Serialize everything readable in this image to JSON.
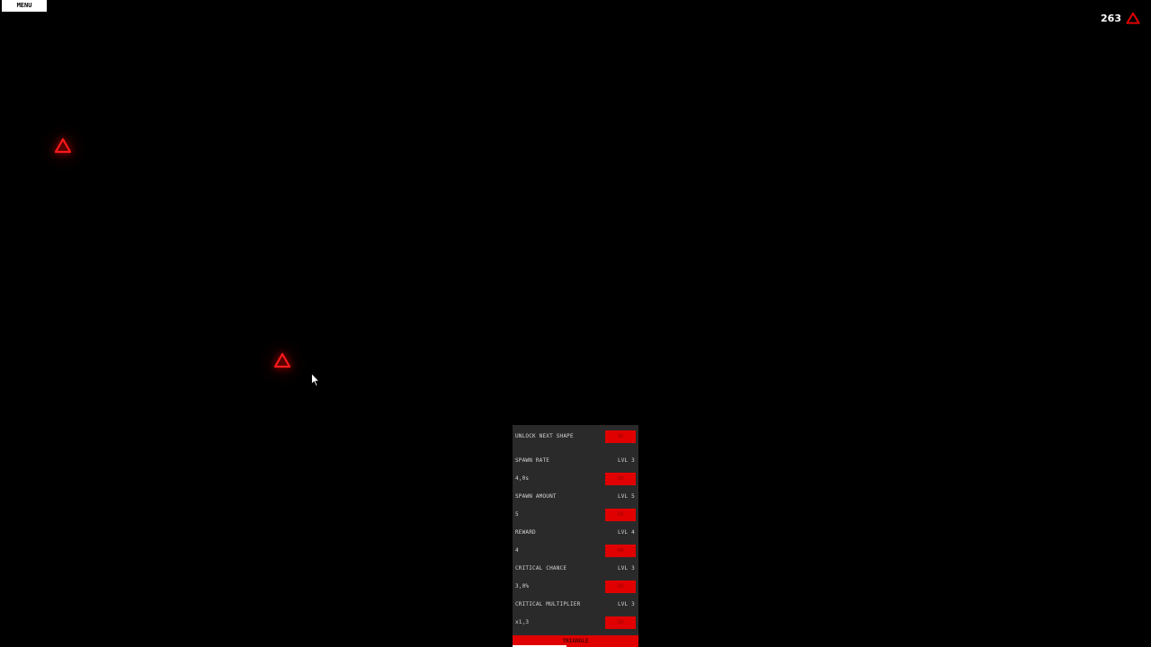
{
  "menu": {
    "label": "MENU"
  },
  "currency": {
    "count": "263",
    "icon": "triangle-icon",
    "color": "#e00000"
  },
  "field": {
    "shapes": [
      {
        "name": "triangle",
        "icon": "triangle-icon"
      },
      {
        "name": "triangle",
        "icon": "triangle-icon"
      }
    ]
  },
  "colors": {
    "background": "#000000",
    "panel": "#2a2a2a",
    "accent": "#e00000",
    "text": "#d4d4d4"
  },
  "panel": {
    "unlock": {
      "label": "UNLOCK NEXT SHAPE",
      "cost": "1K"
    },
    "upgrades": [
      {
        "label": "SPAWN RATE",
        "level": "LVL 3",
        "value": "4,0s",
        "cost": "30"
      },
      {
        "label": "SPAWN AMOUNT",
        "level": "LVL 5",
        "value": "5",
        "cost": "50"
      },
      {
        "label": "REWARD",
        "level": "LVL 4",
        "value": "4",
        "cost": "40"
      },
      {
        "label": "CRITICAL CHANCE",
        "level": "LVL 3",
        "value": "3,0%",
        "cost": "30"
      },
      {
        "label": "CRITICAL MULTIPLIER",
        "level": "LVL 3",
        "value": "x1,3",
        "cost": "30"
      }
    ],
    "tab": {
      "label": "TRIANGLE",
      "progress": 0.43
    }
  }
}
